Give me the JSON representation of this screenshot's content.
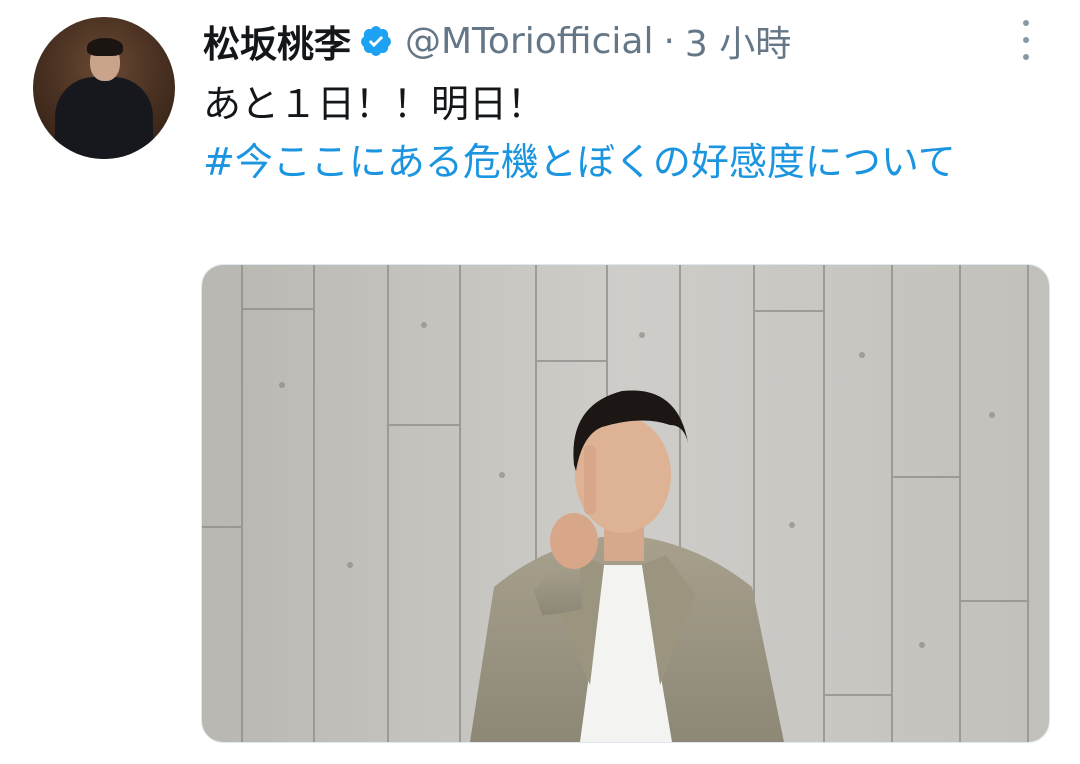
{
  "tweet": {
    "author": {
      "display_name": "松坂桃李",
      "handle": "@MToriofficial",
      "verified": true
    },
    "separator": "·",
    "time": "3 小時",
    "text": "あと１日！！明日！",
    "hashtag": "#今ここにある危機とぼくの好感度について",
    "media": {
      "type": "photo"
    }
  },
  "colors": {
    "name": "#14171a",
    "secondary": "#657786",
    "link": "#1b95e0",
    "verified": "#1da1f2"
  },
  "icons": {
    "verified": "verified-badge-icon",
    "more": "more-vertical-icon"
  }
}
